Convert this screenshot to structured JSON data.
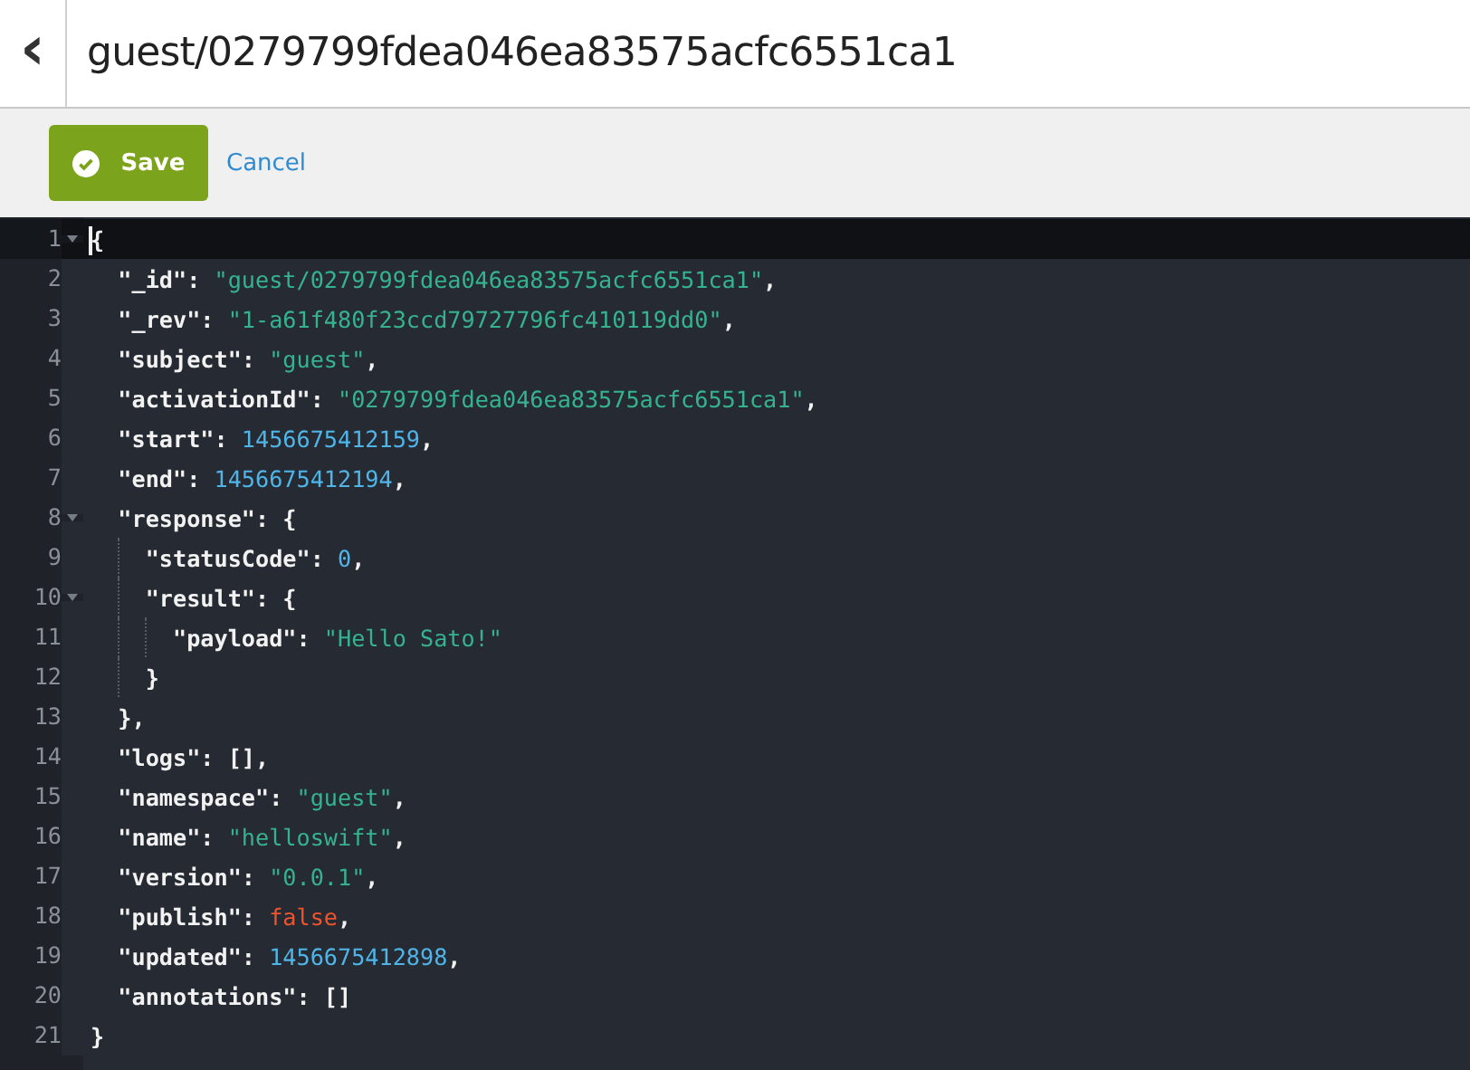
{
  "header": {
    "back": "‹",
    "title": "guest/0279799fdea046ea83575acfc6551ca1"
  },
  "toolbar": {
    "save": "Save",
    "cancel": "Cancel"
  },
  "editor": {
    "lines": [
      {
        "number": "1",
        "fold": true,
        "active": true,
        "tokens": [
          {
            "kind": "punct",
            "text": "{"
          }
        ]
      },
      {
        "number": "2",
        "fold": false,
        "active": false,
        "tokens": [
          {
            "kind": "key",
            "text": "  \"_id\""
          },
          {
            "kind": "punct",
            "text": ": "
          },
          {
            "kind": "string",
            "text": "\"guest/0279799fdea046ea83575acfc6551ca1\""
          },
          {
            "kind": "punct",
            "text": ","
          }
        ]
      },
      {
        "number": "3",
        "fold": false,
        "active": false,
        "tokens": [
          {
            "kind": "key",
            "text": "  \"_rev\""
          },
          {
            "kind": "punct",
            "text": ": "
          },
          {
            "kind": "string",
            "text": "\"1-a61f480f23ccd79727796fc410119dd0\""
          },
          {
            "kind": "punct",
            "text": ","
          }
        ]
      },
      {
        "number": "4",
        "fold": false,
        "active": false,
        "tokens": [
          {
            "kind": "key",
            "text": "  \"subject\""
          },
          {
            "kind": "punct",
            "text": ": "
          },
          {
            "kind": "string",
            "text": "\"guest\""
          },
          {
            "kind": "punct",
            "text": ","
          }
        ]
      },
      {
        "number": "5",
        "fold": false,
        "active": false,
        "tokens": [
          {
            "kind": "key",
            "text": "  \"activationId\""
          },
          {
            "kind": "punct",
            "text": ": "
          },
          {
            "kind": "string",
            "text": "\"0279799fdea046ea83575acfc6551ca1\""
          },
          {
            "kind": "punct",
            "text": ","
          }
        ]
      },
      {
        "number": "6",
        "fold": false,
        "active": false,
        "tokens": [
          {
            "kind": "key",
            "text": "  \"start\""
          },
          {
            "kind": "punct",
            "text": ": "
          },
          {
            "kind": "number",
            "text": "1456675412159"
          },
          {
            "kind": "punct",
            "text": ","
          }
        ]
      },
      {
        "number": "7",
        "fold": false,
        "active": false,
        "tokens": [
          {
            "kind": "key",
            "text": "  \"end\""
          },
          {
            "kind": "punct",
            "text": ": "
          },
          {
            "kind": "number",
            "text": "1456675412194"
          },
          {
            "kind": "punct",
            "text": ","
          }
        ]
      },
      {
        "number": "8",
        "fold": true,
        "active": false,
        "tokens": [
          {
            "kind": "key",
            "text": "  \"response\""
          },
          {
            "kind": "punct",
            "text": ": {"
          }
        ]
      },
      {
        "number": "9",
        "fold": false,
        "active": false,
        "tokens": [
          {
            "kind": "key",
            "text": "    \"statusCode\""
          },
          {
            "kind": "punct",
            "text": ": "
          },
          {
            "kind": "number",
            "text": "0"
          },
          {
            "kind": "punct",
            "text": ","
          }
        ]
      },
      {
        "number": "10",
        "fold": true,
        "active": false,
        "tokens": [
          {
            "kind": "key",
            "text": "    \"result\""
          },
          {
            "kind": "punct",
            "text": ": {"
          }
        ]
      },
      {
        "number": "11",
        "fold": false,
        "active": false,
        "tokens": [
          {
            "kind": "key",
            "text": "      \"payload\""
          },
          {
            "kind": "punct",
            "text": ": "
          },
          {
            "kind": "string",
            "text": "\"Hello Sato!\""
          }
        ]
      },
      {
        "number": "12",
        "fold": false,
        "active": false,
        "tokens": [
          {
            "kind": "punct",
            "text": "    }"
          }
        ]
      },
      {
        "number": "13",
        "fold": false,
        "active": false,
        "tokens": [
          {
            "kind": "punct",
            "text": "  },"
          }
        ]
      },
      {
        "number": "14",
        "fold": false,
        "active": false,
        "tokens": [
          {
            "kind": "key",
            "text": "  \"logs\""
          },
          {
            "kind": "punct",
            "text": ": [],"
          }
        ]
      },
      {
        "number": "15",
        "fold": false,
        "active": false,
        "tokens": [
          {
            "kind": "key",
            "text": "  \"namespace\""
          },
          {
            "kind": "punct",
            "text": ": "
          },
          {
            "kind": "string",
            "text": "\"guest\""
          },
          {
            "kind": "punct",
            "text": ","
          }
        ]
      },
      {
        "number": "16",
        "fold": false,
        "active": false,
        "tokens": [
          {
            "kind": "key",
            "text": "  \"name\""
          },
          {
            "kind": "punct",
            "text": ": "
          },
          {
            "kind": "string",
            "text": "\"helloswift\""
          },
          {
            "kind": "punct",
            "text": ","
          }
        ]
      },
      {
        "number": "17",
        "fold": false,
        "active": false,
        "tokens": [
          {
            "kind": "key",
            "text": "  \"version\""
          },
          {
            "kind": "punct",
            "text": ": "
          },
          {
            "kind": "string",
            "text": "\"0.0.1\""
          },
          {
            "kind": "punct",
            "text": ","
          }
        ]
      },
      {
        "number": "18",
        "fold": false,
        "active": false,
        "tokens": [
          {
            "kind": "key",
            "text": "  \"publish\""
          },
          {
            "kind": "punct",
            "text": ": "
          },
          {
            "kind": "boolean",
            "text": "false"
          },
          {
            "kind": "punct",
            "text": ","
          }
        ]
      },
      {
        "number": "19",
        "fold": false,
        "active": false,
        "tokens": [
          {
            "kind": "key",
            "text": "  \"updated\""
          },
          {
            "kind": "punct",
            "text": ": "
          },
          {
            "kind": "number",
            "text": "1456675412898"
          },
          {
            "kind": "punct",
            "text": ","
          }
        ]
      },
      {
        "number": "20",
        "fold": false,
        "active": false,
        "tokens": [
          {
            "kind": "key",
            "text": "  \"annotations\""
          },
          {
            "kind": "punct",
            "text": ": []"
          }
        ]
      },
      {
        "number": "21",
        "fold": false,
        "active": false,
        "tokens": [
          {
            "kind": "punct",
            "text": "}"
          }
        ]
      }
    ]
  }
}
